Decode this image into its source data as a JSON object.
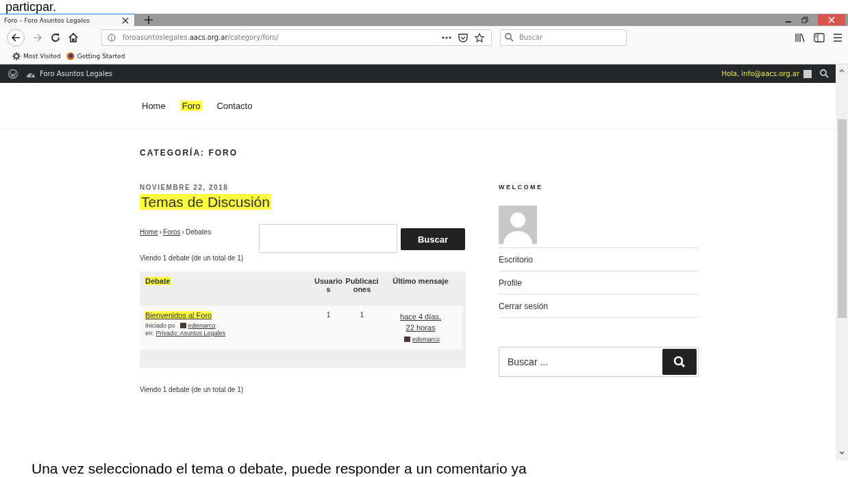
{
  "document": {
    "text_above": "particpar.",
    "text_below": "Una vez seleccionado el tema o debate, puede responder a un comentario ya"
  },
  "browser": {
    "tabs": [
      {
        "title": "Foro – Foro Asuntos Legales",
        "selected": true
      }
    ],
    "url": {
      "host_prefix": "foroasuntoslegales.",
      "domain": "aacs.org.ar",
      "path": "/category/foro/"
    },
    "search": {
      "placeholder": "Buscar"
    },
    "bookmarks": [
      "Most Visited",
      "Getting Started"
    ]
  },
  "admin_bar": {
    "site": "Foro Asuntos Legales",
    "greeting": "Hola, info@aacs.org.ar"
  },
  "site_nav": [
    {
      "label": "Home",
      "highlighted": false
    },
    {
      "label": "Foro",
      "highlighted": true
    },
    {
      "label": "Contacto",
      "highlighted": false
    }
  ],
  "page_title": "CATEGORÍA: FORO",
  "post": {
    "date": "NOVIEMBRE 22, 2018",
    "title": "Temas de Discusión",
    "title_highlighted": true,
    "breadcrumbs": [
      {
        "label": "Home",
        "link": true
      },
      {
        "label": "Foros",
        "link": true
      },
      {
        "label": "Debates",
        "link": false
      }
    ],
    "breadcrumb_separator": "›",
    "search_button": "Buscar",
    "count_top": "Viendo 1 debate (de un total de 1)",
    "table": {
      "columns": [
        {
          "label": "Debate",
          "highlighted": true
        },
        {
          "label": "Usuarios",
          "highlighted": false
        },
        {
          "label": "Publicaciones",
          "highlighted": false
        },
        {
          "label": "Último mensaje",
          "highlighted": false
        }
      ],
      "rows": [
        {
          "title": "Bienvenidos al Foro",
          "highlighted": true,
          "started_by_label": "Iniciado po",
          "author": "edemarco",
          "in_label": "en:",
          "forum": "Privado: Asuntos Legales",
          "users": "1",
          "posts": "1",
          "last_time": "hace 4 días, 22 horas",
          "last_author": "edemarco"
        }
      ]
    },
    "count_bottom": "Viendo 1 debate (de un total de 1)"
  },
  "sidebar": {
    "title": "WELCOME",
    "links": [
      "Escritorio",
      "Profile",
      "Cerrar sesión"
    ],
    "search": {
      "placeholder": "Buscar ..."
    }
  }
}
